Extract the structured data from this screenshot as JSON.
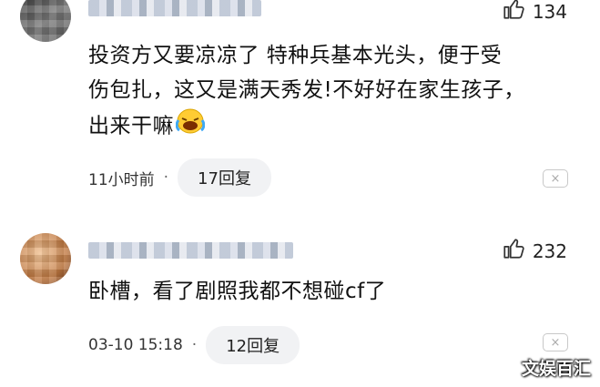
{
  "comments": [
    {
      "likes": "134",
      "text_lines": [
        "投资方又要凉凉了 特种兵基本光头，便于受",
        "伤包扎，这又是满天秀发!不好好在家生孩子，",
        "出来干嘛"
      ],
      "time": "11小时前",
      "dot": "·",
      "reply": "17回复",
      "close": "×"
    },
    {
      "likes": "232",
      "text_lines": [
        "卧槽，看了剧照我都不想碰cf了"
      ],
      "time": "03-10 15:18",
      "dot": "·",
      "reply": "12回复",
      "close": "×"
    }
  ],
  "watermark": "文娱百汇",
  "icons": {
    "like": "thumbs-up-icon",
    "close": "close-icon",
    "emoji": "crying-laughing-emoji"
  }
}
